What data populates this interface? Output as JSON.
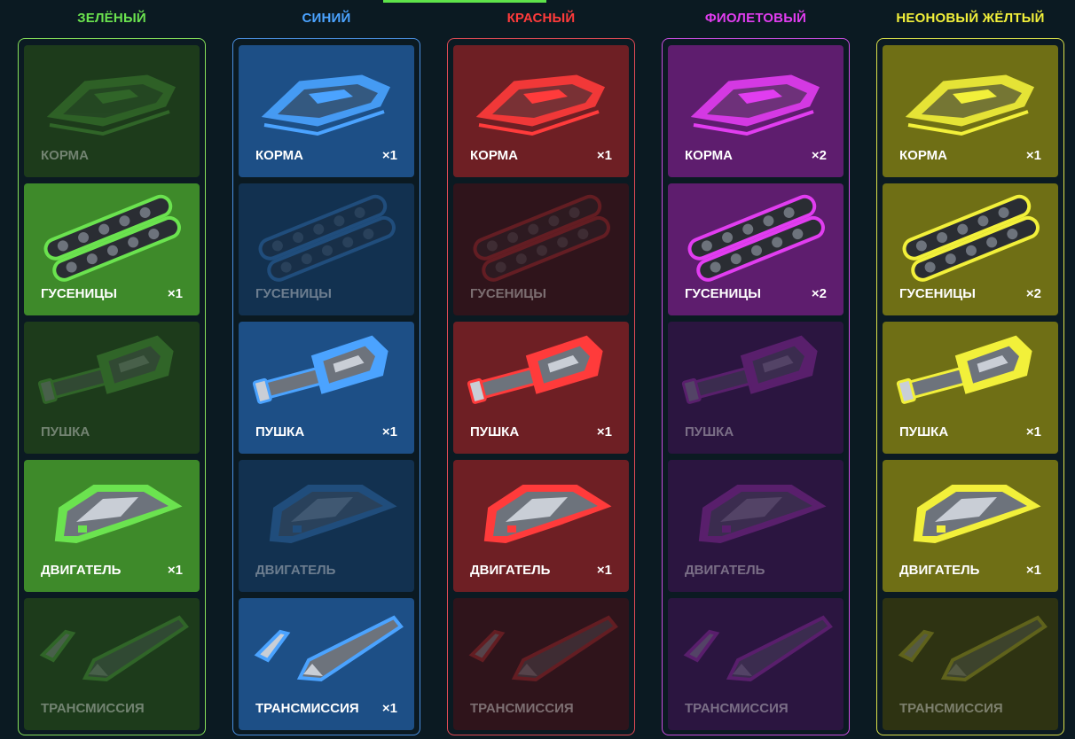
{
  "columns": [
    {
      "title": "ЗЕЛЁНЫЙ",
      "color": "#6be34f",
      "frame": "#86e05a",
      "cards": [
        {
          "label": "КОРМА",
          "count": "",
          "active": false,
          "icon": "hull-icon"
        },
        {
          "label": "ГУСЕНИЦЫ",
          "count": "×1",
          "active": true,
          "icon": "tracks-icon"
        },
        {
          "label": "ПУШКА",
          "count": "",
          "active": false,
          "icon": "cannon-icon"
        },
        {
          "label": "ДВИГАТЕЛЬ",
          "count": "×1",
          "active": true,
          "icon": "engine-icon"
        },
        {
          "label": "ТРАНСМИССИЯ",
          "count": "",
          "active": false,
          "icon": "transmission-icon"
        }
      ]
    },
    {
      "title": "СИНИЙ",
      "color": "#4ba3ff",
      "frame": "#4a8fe0",
      "cards": [
        {
          "label": "КОРМА",
          "count": "×1",
          "active": true,
          "icon": "hull-icon"
        },
        {
          "label": "ГУСЕНИЦЫ",
          "count": "",
          "active": false,
          "icon": "tracks-icon"
        },
        {
          "label": "ПУШКА",
          "count": "×1",
          "active": true,
          "icon": "cannon-icon"
        },
        {
          "label": "ДВИГАТЕЛЬ",
          "count": "",
          "active": false,
          "icon": "engine-icon"
        },
        {
          "label": "ТРАНСМИССИЯ",
          "count": "×1",
          "active": true,
          "icon": "transmission-icon"
        }
      ]
    },
    {
      "title": "КРАСНЫЙ",
      "color": "#ff3b3b",
      "frame": "#e04a55",
      "cards": [
        {
          "label": "КОРМА",
          "count": "×1",
          "active": true,
          "icon": "hull-icon"
        },
        {
          "label": "ГУСЕНИЦЫ",
          "count": "",
          "active": false,
          "icon": "tracks-icon"
        },
        {
          "label": "ПУШКА",
          "count": "×1",
          "active": true,
          "icon": "cannon-icon"
        },
        {
          "label": "ДВИГАТЕЛЬ",
          "count": "×1",
          "active": true,
          "icon": "engine-icon"
        },
        {
          "label": "ТРАНСМИССИЯ",
          "count": "",
          "active": false,
          "icon": "transmission-icon"
        }
      ]
    },
    {
      "title": "ФИОЛЕТОВЫЙ",
      "color": "#e13df0",
      "frame": "#c94ee0",
      "cards": [
        {
          "label": "КОРМА",
          "count": "×2",
          "active": true,
          "icon": "hull-icon"
        },
        {
          "label": "ГУСЕНИЦЫ",
          "count": "×2",
          "active": true,
          "icon": "tracks-icon"
        },
        {
          "label": "ПУШКА",
          "count": "",
          "active": false,
          "icon": "cannon-icon"
        },
        {
          "label": "ДВИГАТЕЛЬ",
          "count": "",
          "active": false,
          "icon": "engine-icon"
        },
        {
          "label": "ТРАНСМИССИЯ",
          "count": "",
          "active": false,
          "icon": "transmission-icon"
        }
      ]
    },
    {
      "title": "НЕОНОВЫЙ ЖЁЛТЫЙ",
      "color": "#f2f03a",
      "frame": "#d9e04a",
      "cards": [
        {
          "label": "КОРМА",
          "count": "×1",
          "active": true,
          "icon": "hull-icon"
        },
        {
          "label": "ГУСЕНИЦЫ",
          "count": "×2",
          "active": true,
          "icon": "tracks-icon"
        },
        {
          "label": "ПУШКА",
          "count": "×1",
          "active": true,
          "icon": "cannon-icon"
        },
        {
          "label": "ДВИГАТЕЛЬ",
          "count": "×1",
          "active": true,
          "icon": "engine-icon"
        },
        {
          "label": "ТРАНСМИССИЯ",
          "count": "",
          "active": false,
          "icon": "transmission-icon"
        }
      ]
    }
  ],
  "theme": {
    "background": "#0b1a22",
    "card_backgrounds": {
      "active": [
        "#3e8a2a",
        "#1d4f86",
        "#6e1f24",
        "#5e1d6e",
        "#6f6f15"
      ],
      "inactive": [
        "#1d3b1b",
        "#123150",
        "#2f141b",
        "#2b1540",
        "#2e3312"
      ]
    }
  }
}
